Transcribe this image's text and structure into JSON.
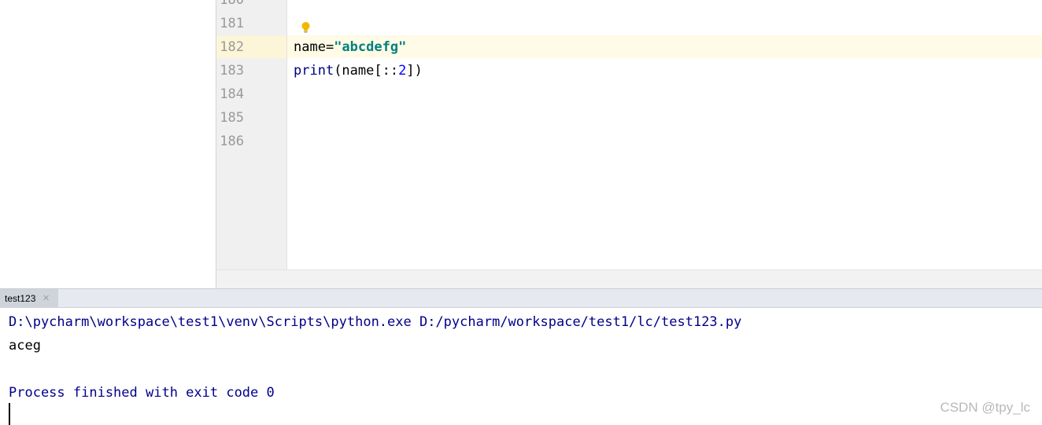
{
  "editor": {
    "line_numbers": [
      "180",
      "181",
      "182",
      "183",
      "184",
      "185",
      "186"
    ],
    "current_line": "182",
    "code_lines": [
      {
        "number": "182",
        "parts": [
          {
            "text": "name=",
            "kind": "plain"
          },
          {
            "text": "\"abcdefg\"",
            "kind": "string"
          }
        ]
      },
      {
        "number": "183",
        "parts": [
          {
            "text": "print",
            "kind": "builtin"
          },
          {
            "text": "(name[::",
            "kind": "plain"
          },
          {
            "text": "2",
            "kind": "number"
          },
          {
            "text": "])",
            "kind": "plain"
          }
        ]
      }
    ],
    "intention_icon": "lightbulb-icon"
  },
  "run_panel": {
    "tab_label": "test123",
    "tab_close_icon": "close-icon",
    "console": {
      "command": "D:\\pycharm\\workspace\\test1\\venv\\Scripts\\python.exe D:/pycharm/workspace/test1/lc/test123.py",
      "output": "aceg",
      "exit_message": "Process finished with exit code 0"
    }
  },
  "watermark": "CSDN @tpy_lc",
  "colors": {
    "string": "#008080",
    "builtin": "#000080",
    "number": "#0000ff",
    "console_system": "#00008b",
    "current_line": "#fffbe6"
  }
}
